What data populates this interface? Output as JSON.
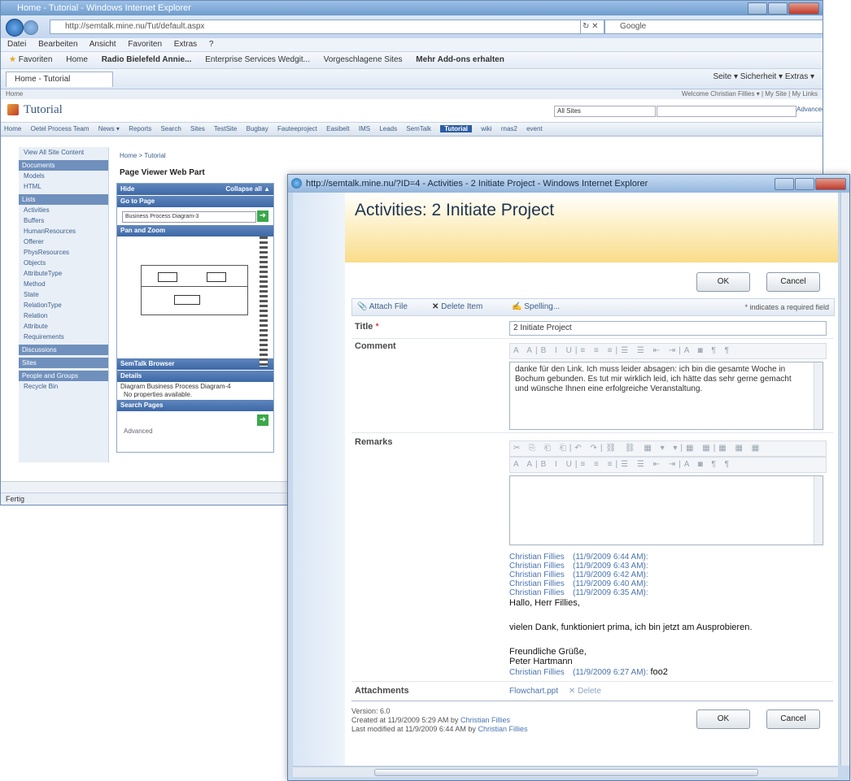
{
  "bg": {
    "window_title": "Home - Tutorial - Windows Internet Explorer",
    "address": "http://semtalk.mine.nu/Tut/default.aspx",
    "search_engine": "Google",
    "menu": [
      "Datei",
      "Bearbeiten",
      "Ansicht",
      "Favoriten",
      "Extras",
      "?"
    ],
    "favorites": [
      "Favoriten",
      "Home",
      "Radio Bielefeld Annie...",
      "Enterprise Services Wedgit...",
      "Vorgeschlagene Sites",
      "Mehr Add-ons erhalten"
    ],
    "tab_label": "Home - Tutorial",
    "commands": "Seite ▾  Sicherheit ▾  Extras ▾",
    "sp_top_left": "Home",
    "sp_top_right": "Welcome Christian Fillies ▾ | My Site | My Links",
    "site_title": "Tutorial",
    "search_scope": "All Sites",
    "search_adv": "Advanced",
    "nav": [
      "Home",
      "Oetel Process Team",
      "News ▾",
      "Reports",
      "Search",
      "Sites",
      "TestSite",
      "Bugbay",
      "Fauteeproject",
      "Easibelt",
      "IMS",
      "Leads",
      "SemTalk",
      "Tutorial",
      "wiki",
      "rnas2",
      "event"
    ],
    "nav_selected": "Tutorial",
    "quick_launch": {
      "view_all": "View All Site Content",
      "documents_header": "Documents",
      "documents": [
        "Models",
        "HTML"
      ],
      "lists_header": "Lists",
      "lists": [
        "Activities",
        "Buffers",
        "HumanResources",
        "Offerer",
        "PhysResources",
        "Objects",
        "AttributeType",
        "Method",
        "State",
        "RelationType",
        "Relation",
        "Attribute",
        "Requirements"
      ],
      "discussions": "Discussions",
      "sites": "Sites",
      "people": "People and Groups",
      "recycle": "Recycle Bin"
    },
    "breadcrumb": "Home > Tutorial",
    "webpart_title": "Page Viewer Web Part",
    "webpart_hd": "Hide",
    "webpart_collapse": "Collapse all ▲",
    "goto_page": "Go to Page",
    "goto_value": "Business Process Diagram-3",
    "pan_zoom": "Pan and Zoom",
    "semtalk_browser": "SemTalk Browser",
    "details": "Details",
    "details_text1": "Diagram Business Process Diagram-4",
    "details_text2": "No properties available.",
    "search_pages": "Search Pages",
    "advanced": "Advanced",
    "status": "Fertig"
  },
  "dlg": {
    "window_title": "http://semtalk.mine.nu/?ID=4 - Activities - 2 Initiate Project - Windows Internet Explorer",
    "heading": "Activities: 2 Initiate Project",
    "ok": "OK",
    "cancel": "Cancel",
    "toolbar": {
      "attach": "Attach File",
      "delete": "Delete Item",
      "spelling": "Spelling...",
      "required_note": "* indicates a required field"
    },
    "fields": {
      "title_label": "Title",
      "title_req": "*",
      "title_value": "2 Initiate Project",
      "comment_label": "Comment",
      "comment_value": "danke für den Link. Ich muss leider absagen: ich bin die gesamte Woche in Bochum gebunden. Es tut mir wirklich leid, ich hätte das sehr gerne gemacht und wünsche Ihnen eine erfolgreiche Veranstaltung.",
      "remarks_label": "Remarks",
      "attachments_label": "Attachments",
      "attachment_file": "Flowchart.ppt",
      "attachment_delete": "Delete"
    },
    "rte_toolbar_row1": "A A|B I U|≡ ≡ ≡|☰ ☰ ⇤ ⇥|A ◙ ¶ ¶",
    "rte_toolbar_row2": "✂ ⎘ ⎗ ⎗|↶ ↷|⛓ ⛓ ▦ ▾ ▾|▦ ▦|▦ ▦ ▦",
    "history": [
      {
        "name": "Christian Fillies",
        "time": "(11/9/2009 6:44 AM):"
      },
      {
        "name": "Christian Fillies",
        "time": "(11/9/2009 6:43 AM):"
      },
      {
        "name": "Christian Fillies",
        "time": "(11/9/2009 6:42 AM):"
      },
      {
        "name": "Christian Fillies",
        "time": "(11/9/2009 6:40 AM):"
      },
      {
        "name": "Christian Fillies",
        "time": "(11/9/2009 6:35 AM):"
      }
    ],
    "message": {
      "greeting": "Hallo, Herr Fillies,",
      "body": "vielen Dank, funktioniert prima, ich bin jetzt am Ausprobieren.",
      "closing1": "Freundliche Grüße,",
      "closing2": "Peter Hartmann"
    },
    "last_entry": {
      "name": "Christian Fillies",
      "time": "(11/9/2009 6:27 AM):",
      "text": "foo2"
    },
    "footer": {
      "version": "Version: 6.0",
      "created": "Created at 11/9/2009 5:29 AM  by",
      "created_by": "Christian Fillies",
      "modified": "Last modified at 11/9/2009 6:44 AM  by",
      "modified_by": "Christian Fillies"
    }
  }
}
